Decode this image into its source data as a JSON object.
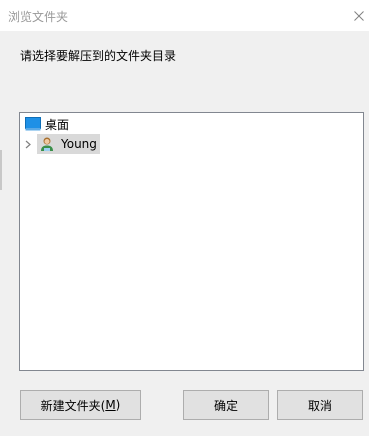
{
  "window": {
    "title": "浏览文件夹"
  },
  "prompt": "请选择要解压到的文件夹目录",
  "tree": {
    "items": [
      {
        "label": "桌面",
        "icon": "desktop-icon",
        "expandable": false,
        "selected": false
      },
      {
        "label": "Young",
        "icon": "user-icon",
        "expandable": true,
        "selected": true
      }
    ]
  },
  "buttons": {
    "new_folder_prefix": "新建文件夹(",
    "new_folder_mnemonic": "M",
    "new_folder_suffix": ")",
    "ok": "确定",
    "cancel": "取消"
  },
  "colors": {
    "selection": "#d9d9d9",
    "desktop_icon": "#1e90e6",
    "title_text": "#999999"
  }
}
